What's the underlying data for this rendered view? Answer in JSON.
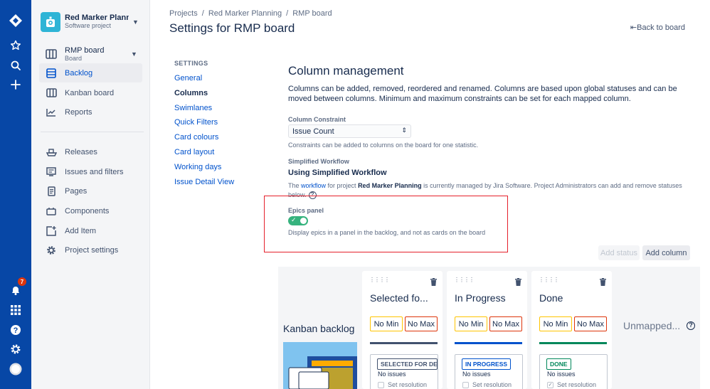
{
  "project": {
    "name": "Red Marker Plann",
    "type": "Software project"
  },
  "board": {
    "name": "RMP board",
    "type": "Board"
  },
  "notifications": {
    "count": "7"
  },
  "sidebar": {
    "items": [
      {
        "label": "Backlog"
      },
      {
        "label": "Kanban board"
      },
      {
        "label": "Reports"
      },
      {
        "label": "Releases"
      },
      {
        "label": "Issues and filters"
      },
      {
        "label": "Pages"
      },
      {
        "label": "Components"
      },
      {
        "label": "Add Item"
      },
      {
        "label": "Project settings"
      }
    ]
  },
  "breadcrumbs": [
    "Projects",
    "Red Marker Planning",
    "RMP board"
  ],
  "page_title": "Settings for RMP board",
  "back_link": "Back to board",
  "settings_nav": {
    "heading": "SETTINGS",
    "items": [
      "General",
      "Columns",
      "Swimlanes",
      "Quick Filters",
      "Card colours",
      "Card layout",
      "Working days",
      "Issue Detail View"
    ]
  },
  "column_management": {
    "title": "Column management",
    "description": "Columns can be added, removed, reordered and renamed. Columns are based upon global statuses and can be moved between columns. Minimum and maximum constraints can be set for each mapped column.",
    "constraint_label": "Column Constraint",
    "constraint_value": "Issue Count",
    "constraint_help": "Constraints can be added to columns on the board for one statistic.",
    "workflow_label": "Simplified Workflow",
    "workflow_title": "Using Simplified Workflow",
    "workflow_text_1": "The ",
    "workflow_link": "workflow",
    "workflow_text_2": " for project ",
    "workflow_project": "Red Marker Planning",
    "workflow_text_3": " is currently managed by Jira Software. Project Administrators can add and remove statuses below.",
    "epics_label": "Epics panel",
    "epics_on": true,
    "epics_help": "Display epics in a panel in the backlog, and not as cards on the board",
    "add_status": "Add status",
    "add_column": "Add column"
  },
  "kanban_backlog": "Kanban backlog",
  "unmapped": "Unmapped...",
  "columns": [
    {
      "title": "Selected fo...",
      "min": "No Min",
      "max": "No Max",
      "status": "SELECTED FOR DEVELOPMENT",
      "issues": "No issues",
      "resolution": "Set resolution",
      "resolution_checked": false,
      "color": "#42526e"
    },
    {
      "title": "In Progress",
      "min": "No Min",
      "max": "No Max",
      "status": "IN PROGRESS",
      "issues": "No issues",
      "resolution": "Set resolution",
      "resolution_checked": false,
      "color": "#0052cc"
    },
    {
      "title": "Done",
      "min": "No Min",
      "max": "No Max",
      "status": "DONE",
      "issues": "No issues",
      "resolution": "Set resolution",
      "resolution_checked": true,
      "color": "#00875a"
    }
  ]
}
